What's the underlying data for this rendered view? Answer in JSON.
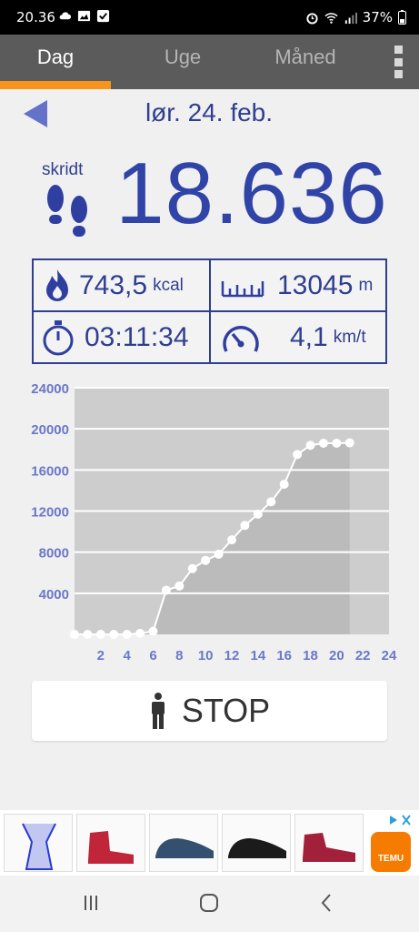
{
  "status_bar": {
    "time": "20.36",
    "battery": "37%"
  },
  "tabs": [
    {
      "label": "Dag",
      "active": true
    },
    {
      "label": "Uge",
      "active": false
    },
    {
      "label": "Måned",
      "active": false
    }
  ],
  "header": {
    "date": "lør. 24. feb."
  },
  "steps": {
    "label": "skridt",
    "value": "18.636"
  },
  "stats": {
    "calories": {
      "value": "743,5",
      "unit": "kcal"
    },
    "distance": {
      "value": "13045",
      "unit": "m"
    },
    "duration": {
      "value": "03:11:34"
    },
    "speed": {
      "value": "4,1",
      "unit": "km/t"
    }
  },
  "stop_button": {
    "label": "STOP"
  },
  "ad": {
    "brand": "TEMU"
  },
  "colors": {
    "accent": "#f7941d",
    "primary": "#2f3f8f",
    "chart_fill": "#bbbbbb",
    "chart_bg": "#cdcdcd"
  },
  "chart_data": {
    "type": "area",
    "title": "",
    "xlabel": "",
    "ylabel": "",
    "x_ticks": [
      2,
      4,
      6,
      8,
      10,
      12,
      14,
      16,
      18,
      20,
      22,
      24
    ],
    "y_ticks": [
      4000,
      8000,
      12000,
      16000,
      20000,
      24000
    ],
    "x_range": [
      0,
      24
    ],
    "ylim": [
      0,
      24000
    ],
    "grid": true,
    "x": [
      0,
      1,
      2,
      3,
      4,
      5,
      6,
      7,
      8,
      9,
      10,
      11,
      12,
      13,
      14,
      15,
      16,
      17,
      18,
      19,
      20,
      21
    ],
    "values": [
      0,
      0,
      0,
      0,
      0,
      100,
      300,
      4300,
      4700,
      6400,
      7200,
      7800,
      9200,
      10600,
      11700,
      12900,
      14600,
      17500,
      18400,
      18600,
      18600,
      18636
    ]
  }
}
